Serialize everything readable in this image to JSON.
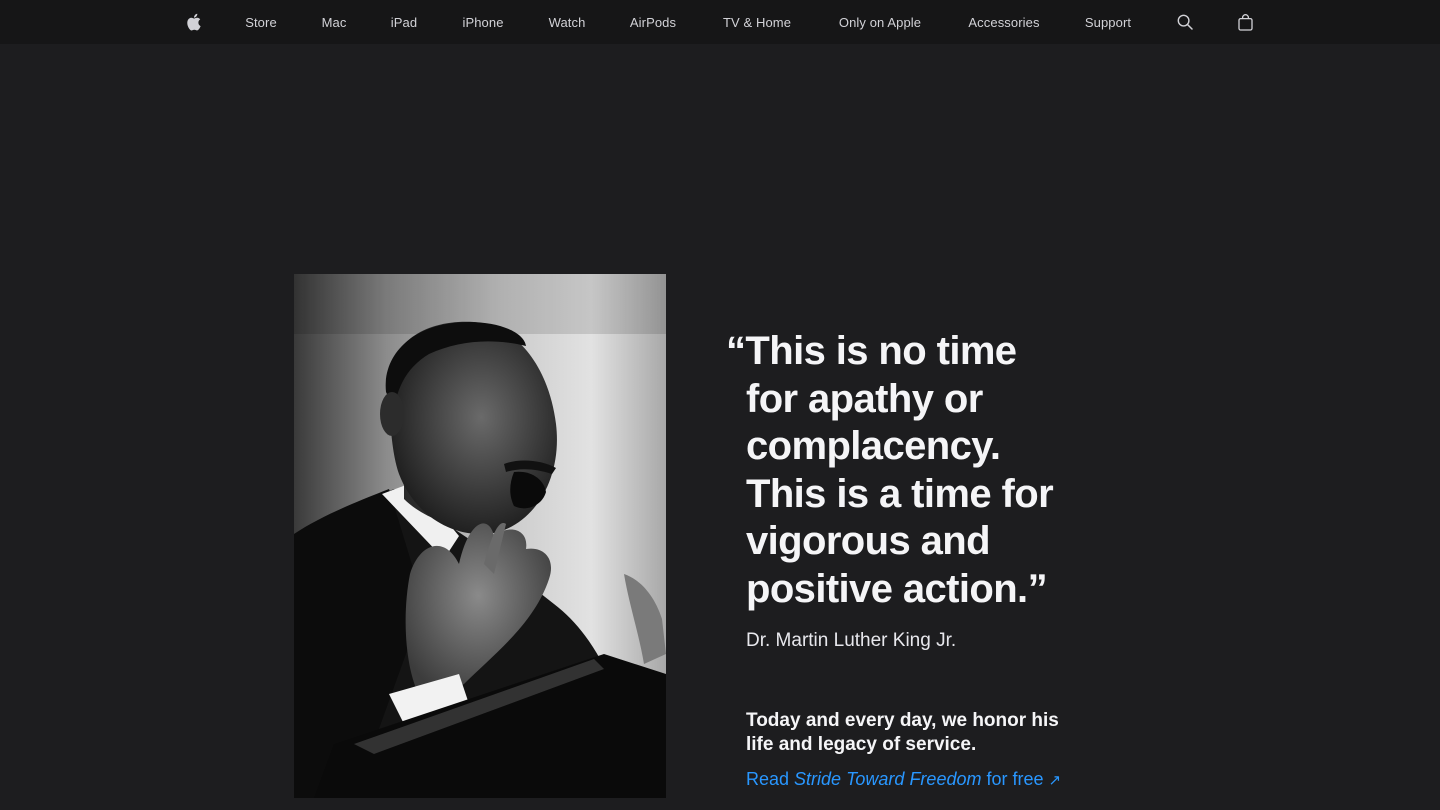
{
  "nav": {
    "apple_logo_icon": "apple-logo",
    "items": [
      {
        "label": "Store"
      },
      {
        "label": "Mac"
      },
      {
        "label": "iPad"
      },
      {
        "label": "iPhone"
      },
      {
        "label": "Watch"
      },
      {
        "label": "AirPods"
      },
      {
        "label": "TV & Home"
      },
      {
        "label": "Only on Apple"
      },
      {
        "label": "Accessories"
      },
      {
        "label": "Support"
      }
    ],
    "search_icon": "search-icon",
    "bag_icon": "bag-icon"
  },
  "hero": {
    "quote_lines": [
      "“This is no time",
      "for apathy or",
      "complacency.",
      "This is a time for",
      "vigorous and",
      "positive action.”"
    ],
    "author": "Dr. Martin Luther King Jr.",
    "honor_lines": [
      "Today and every day, we honor his",
      "life and legacy of service."
    ],
    "cta": {
      "prefix": "Read ",
      "title": "Stride Toward Freedom",
      "suffix": " for free",
      "arrow": "↗"
    }
  },
  "colors": {
    "background": "#1d1d1f",
    "nav_background": "#161617",
    "link": "#2997ff",
    "text": "#f5f5f7"
  }
}
